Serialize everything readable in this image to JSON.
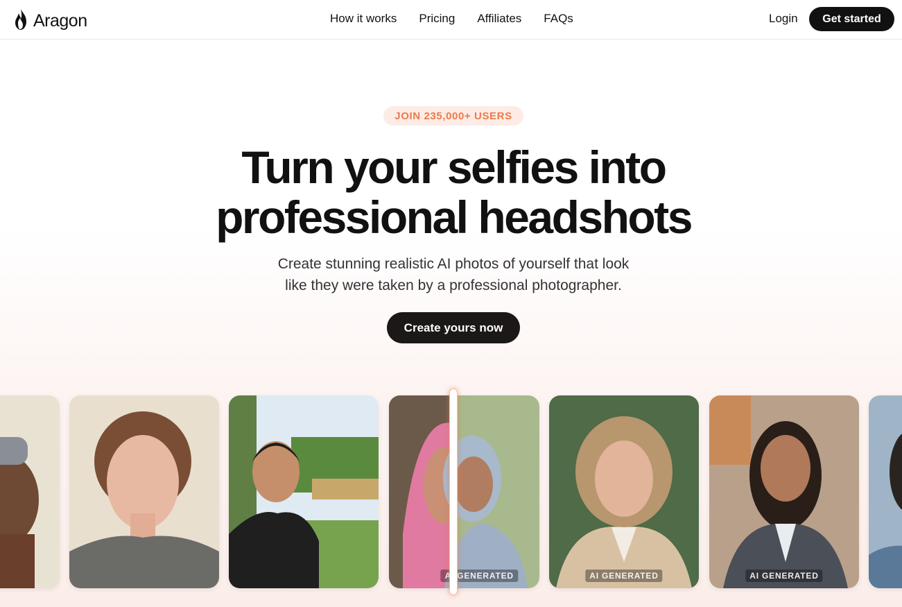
{
  "brand": {
    "name": "Aragon"
  },
  "nav": {
    "links": [
      "How it works",
      "Pricing",
      "Affiliates",
      "FAQs"
    ],
    "login": "Login",
    "cta": "Get started"
  },
  "hero": {
    "badge": "JOIN 235,000+ USERS",
    "headline_line1": "Turn your selfies into",
    "headline_line2": "professional headshots",
    "sub_line1": "Create stunning realistic AI photos of yourself that look",
    "sub_line2": "like they were taken by a professional photographer.",
    "cta": "Create yours now"
  },
  "gallery": {
    "tags": [
      "AI GENERATED",
      "AI GENERATED",
      "AI GENERATED"
    ]
  },
  "colors": {
    "accent": "#ec7a4a",
    "dark": "#111111"
  }
}
